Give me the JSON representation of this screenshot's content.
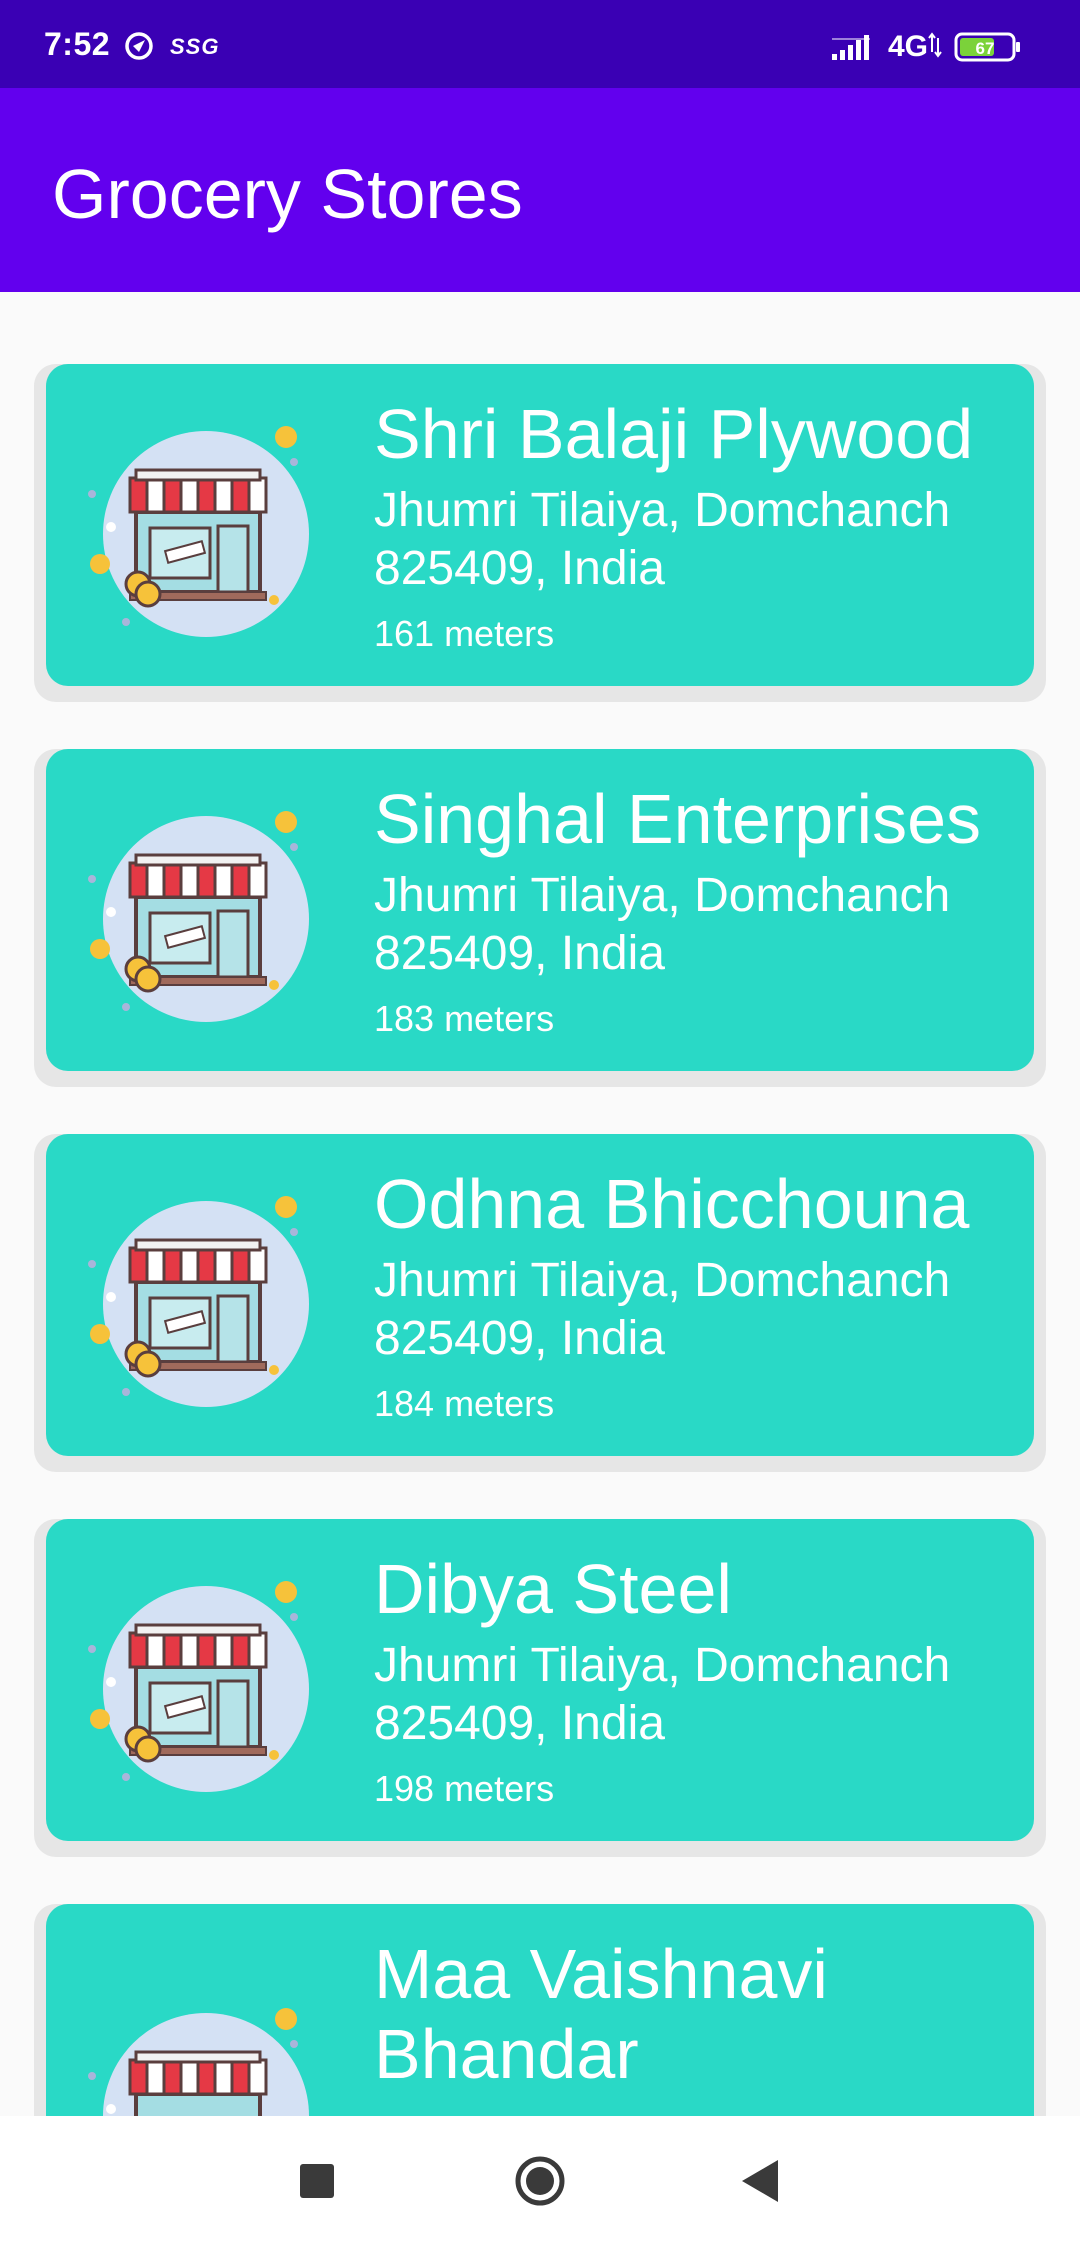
{
  "status_bar": {
    "time": "7:52",
    "carrier": "SSG",
    "network": "4G",
    "battery": "67",
    "icons": [
      "dnd-icon",
      "signal-icon",
      "battery-icon"
    ]
  },
  "app_bar": {
    "title": "Grocery Stores"
  },
  "stores": [
    {
      "name": "Shri Balaji Plywood",
      "address": "Jhumri Tilaiya, Domchanch 825409, India",
      "distance": "161 meters"
    },
    {
      "name": "Singhal Enterprises",
      "address": "Jhumri Tilaiya, Domchanch 825409, India",
      "distance": "183 meters"
    },
    {
      "name": "Odhna Bhicchouna",
      "address": "Jhumri Tilaiya, Domchanch 825409, India",
      "distance": "184 meters"
    },
    {
      "name": "Dibya Steel",
      "address": "Jhumri Tilaiya, Domchanch 825409, India",
      "distance": "198 meters"
    },
    {
      "name": "Maa Vaishnavi Bhandar",
      "address": "",
      "distance": ""
    }
  ],
  "nav_bar": {
    "icons": [
      "recents-icon",
      "home-icon",
      "back-icon"
    ]
  },
  "colors": {
    "status_bar": "#3a00b4",
    "app_bar": "#6200ee",
    "card": "#29d9c6",
    "background": "#fafafa"
  }
}
